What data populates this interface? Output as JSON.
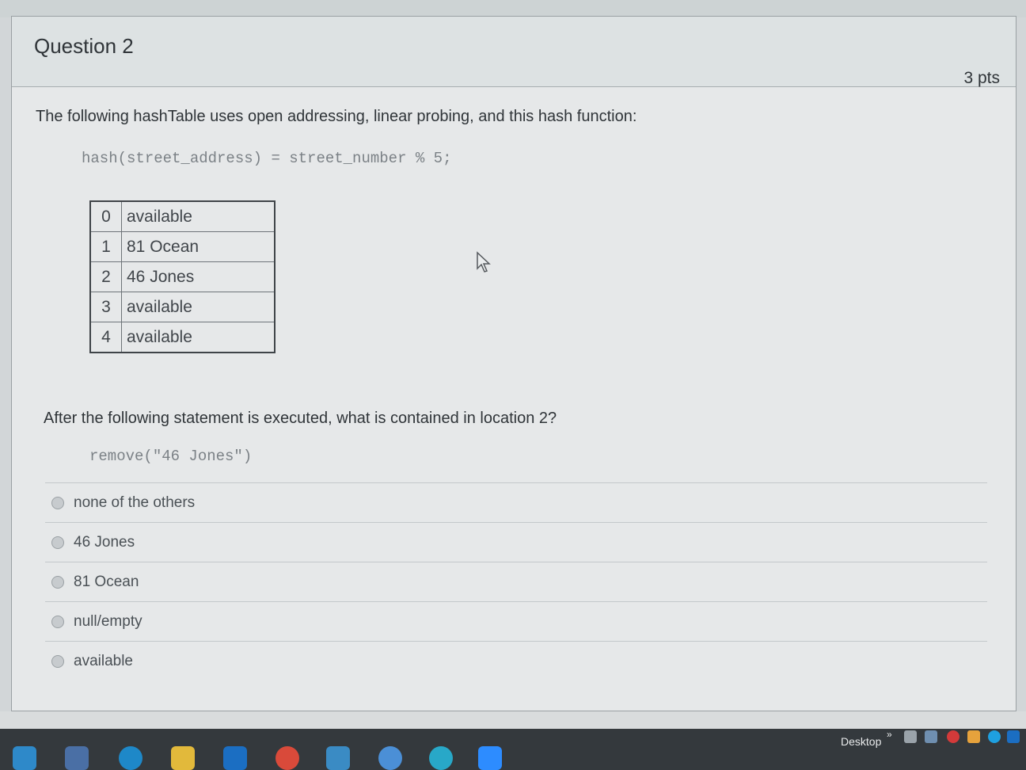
{
  "question": {
    "title": "Question 2",
    "points": "3 pts",
    "prompt": "The following hashTable uses open addressing, linear probing, and this hash function:",
    "hash_code": "hash(street_address) = street_number % 5;",
    "table": [
      {
        "index": "0",
        "value": "available"
      },
      {
        "index": "1",
        "value": "81 Ocean"
      },
      {
        "index": "2",
        "value": "46 Jones"
      },
      {
        "index": "3",
        "value": "available"
      },
      {
        "index": "4",
        "value": "available"
      }
    ],
    "followup": "After the following statement is executed, what is contained in location 2?",
    "remove_code": "remove(\"46 Jones\")",
    "answers": [
      {
        "label": "none of the others"
      },
      {
        "label": "46 Jones"
      },
      {
        "label": "81 Ocean"
      },
      {
        "label": "null/empty"
      },
      {
        "label": "available"
      }
    ]
  },
  "taskbar": {
    "desktop_label": "Desktop",
    "chevron": "»",
    "icons": [
      "windows-start-icon",
      "file-manager-icon",
      "edge-icon",
      "folder-icon",
      "outlook-icon",
      "chrome-icon",
      "store-icon",
      "r-app-icon",
      "p-app-icon",
      "zoom-icon"
    ],
    "tray_icons": [
      "printer-icon",
      "network-icon",
      "vivaldi-icon",
      "mail-icon",
      "skype-icon",
      "outlook-tray-icon"
    ]
  },
  "colors": {
    "card_bg": "#e6e8e9",
    "header_bg": "#dde2e3",
    "taskbar_bg": "#34393d",
    "code_text": "#7b8186"
  }
}
